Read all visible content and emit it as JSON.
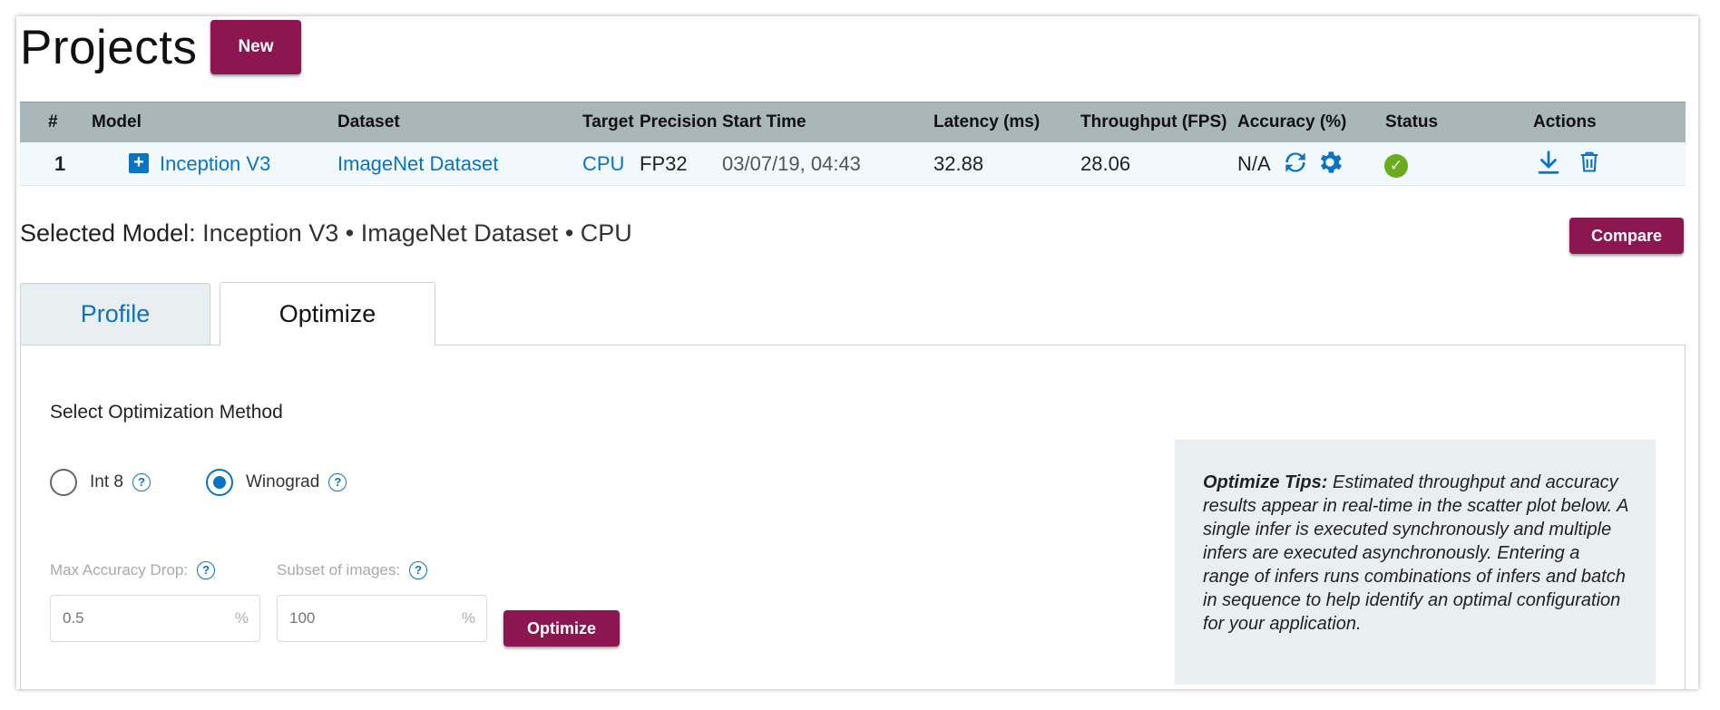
{
  "header": {
    "title": "Projects",
    "new_label": "New"
  },
  "table": {
    "columns": [
      "#",
      "Model",
      "Dataset",
      "Target",
      "Precision",
      "Start Time",
      "Latency (ms)",
      "Throughput (FPS)",
      "Accuracy (%)",
      "Status",
      "Actions"
    ],
    "rows": [
      {
        "index": "1",
        "model": "Inception V3",
        "dataset": "ImageNet Dataset",
        "target": "CPU",
        "precision": "FP32",
        "start_time": "03/07/19, 04:43",
        "latency": "32.88",
        "throughput": "28.06",
        "accuracy": "N/A",
        "status": "success"
      }
    ]
  },
  "selected": {
    "label": "Selected Model:",
    "value": "Inception V3 • ImageNet Dataset • CPU",
    "compare_label": "Compare"
  },
  "tabs": [
    {
      "label": "Profile"
    },
    {
      "label": "Optimize"
    }
  ],
  "optimize": {
    "section_title": "Select Optimization Method",
    "methods": [
      {
        "label": "Int 8",
        "selected": false
      },
      {
        "label": "Winograd",
        "selected": true
      }
    ],
    "max_accuracy_drop": {
      "label": "Max Accuracy Drop:",
      "placeholder": "0.5",
      "unit": "%"
    },
    "subset_of_images": {
      "label": "Subset of images:",
      "placeholder": "100",
      "unit": "%"
    },
    "button_label": "Optimize",
    "tips_title": "Optimize Tips:",
    "tips_text": "Estimated throughput and accuracy results appear in real-time in the scatter plot below. A single infer is executed synchronously and multiple infers are executed asynchronously. Entering a range of infers runs combinations of infers and batch in sequence to help identify an optimal configuration for your application."
  },
  "colors": {
    "brand": "#8b1650",
    "link": "#0a74c2",
    "table_header": "#a9b6ba",
    "status_ok": "#6aab1f"
  }
}
